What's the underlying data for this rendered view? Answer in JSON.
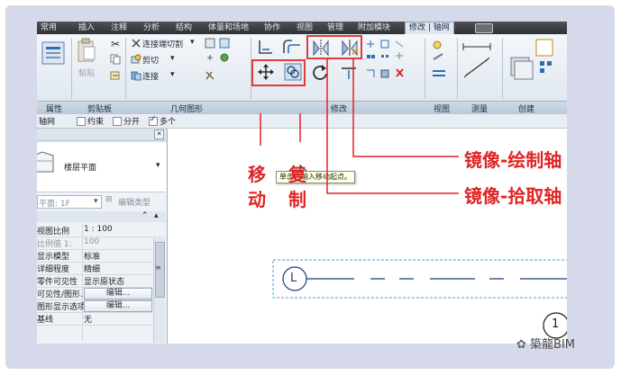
{
  "ribbon": {
    "tabs": [
      "常用",
      "插入",
      "注释",
      "分析",
      "结构",
      "体量和场地",
      "协作",
      "视图",
      "管理",
      "附加模块",
      "修改 | 轴网"
    ],
    "active_tab": "修改 | 轴网",
    "panels": [
      "属性",
      "剪贴板",
      "几何图形",
      "修改",
      "视图",
      "测量",
      "创建"
    ],
    "clipboard": {
      "paste_label": "粘贴"
    },
    "geometry": {
      "cut_join_label": "连接端切割",
      "cut_label": "剪切",
      "join_label": "连接"
    }
  },
  "options_bar": {
    "context_label": "轴网",
    "constrain_label": "约束",
    "disjoin_label": "分开",
    "multiple_label": "多个",
    "constrain_checked": false,
    "disjoin_checked": false,
    "multiple_checked": true
  },
  "properties": {
    "type_name": "楼层平面",
    "view_selector": "平面: 1F",
    "edit_type_label": "编辑类型",
    "rows": [
      {
        "key": "视图比例",
        "value": "1 : 100",
        "dim": false
      },
      {
        "key": "比例值 1:",
        "value": "100",
        "dim": true
      },
      {
        "key": "显示模型",
        "value": "标准",
        "dim": false
      },
      {
        "key": "详细程度",
        "value": "精细",
        "dim": false
      },
      {
        "key": "零件可见性",
        "value": "显示原状态",
        "dim": false
      },
      {
        "key": "可见性/图形...",
        "value": "编辑...",
        "button": true
      },
      {
        "key": "图形显示选项",
        "value": "编辑...",
        "button": true
      },
      {
        "key": "基线",
        "value": "无",
        "dim": false
      }
    ]
  },
  "canvas": {
    "tooltip": "单击可输入移动起点。",
    "grid_bubble_1": "L",
    "grid_bubble_2": "1"
  },
  "annotations": {
    "move": "移动",
    "copy": "复制",
    "mirror_draw": "镜像-绘制轴",
    "mirror_pick": "镜像-拾取轴",
    "color": "#e02424"
  },
  "watermark": "築龍BIM"
}
